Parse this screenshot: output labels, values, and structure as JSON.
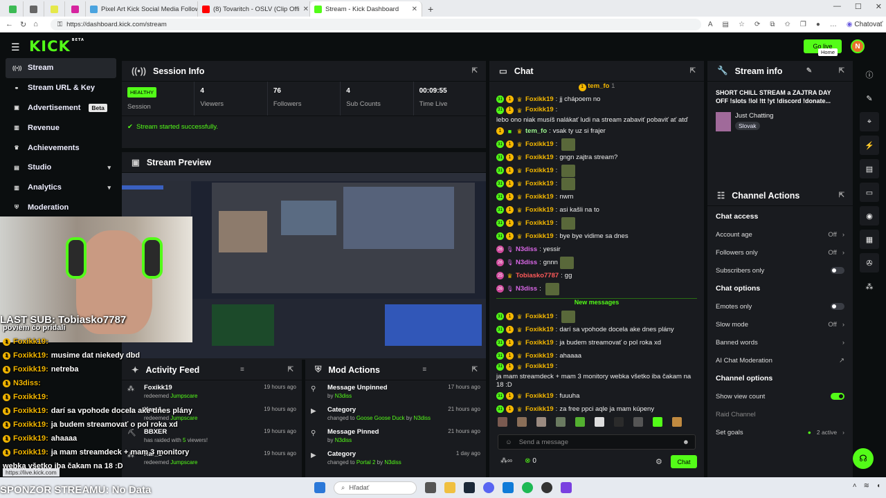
{
  "browser": {
    "tabs": [
      {
        "label": "",
        "color": "#3cba54"
      },
      {
        "label": "",
        "color": "#666"
      },
      {
        "label": "",
        "color": "#e5e84a"
      },
      {
        "label": "",
        "color": "#d6249f"
      },
      {
        "label": "Pixel Art Kick Social Media Follow",
        "color": "#4aa3df"
      },
      {
        "label": "(8) Tovaritch - OSLV (Clip Offi",
        "color": "#ff0000"
      },
      {
        "label": "Stream - Kick Dashboard",
        "color": "#53fc18"
      }
    ],
    "url": "https://dashboard.kick.com/stream",
    "profile_label": "Chatovať",
    "status_url": "https://live.kick.com"
  },
  "topnav": {
    "logo": "KICK",
    "logo_beta": "BETA",
    "go_live": "Go live",
    "tooltip": "Home",
    "avatar_letter": "N"
  },
  "sidebar": {
    "items": [
      {
        "label": "Stream",
        "icon": "broadcast-icon"
      },
      {
        "label": "Stream URL & Key",
        "icon": "link-icon"
      },
      {
        "label": "Advertisement",
        "icon": "ad-icon",
        "badge": "Beta"
      },
      {
        "label": "Revenue",
        "icon": "chart-icon"
      },
      {
        "label": "Achievements",
        "icon": "trophy-icon"
      },
      {
        "label": "Studio",
        "icon": "studio-icon"
      },
      {
        "label": "Analytics",
        "icon": "analytics-icon"
      },
      {
        "label": "Moderation",
        "icon": "shield-icon"
      }
    ]
  },
  "session": {
    "title": "Session Info",
    "healthy": "HEALTHY",
    "session_label": "Session",
    "stats": [
      {
        "value": "4",
        "label": "Viewers"
      },
      {
        "value": "76",
        "label": "Followers"
      },
      {
        "value": "4",
        "label": "Sub Counts"
      },
      {
        "value": "00:09:55",
        "label": "Time Live"
      }
    ],
    "message": "Stream started successfully."
  },
  "preview": {
    "title": "Stream Preview"
  },
  "activity": {
    "title": "Activity Feed",
    "items": [
      {
        "name": "Foxikk19",
        "verb": "redeemed",
        "target": "Jumpscare",
        "tail": "",
        "time": "19 hours ago"
      },
      {
        "name": "Xar_1",
        "verb": "redeemed",
        "target": "Jumpscare",
        "tail": "",
        "time": "19 hours ago"
      },
      {
        "name": "BBXER",
        "verb": "has raided with",
        "target": "5",
        "tail": "viewers!",
        "time": "19 hours ago"
      },
      {
        "name": "Xar_1",
        "verb": "redeemed",
        "target": "Jumpscare",
        "tail": "",
        "time": "19 hours ago"
      }
    ]
  },
  "mod": {
    "title": "Mod Actions",
    "items": [
      {
        "title": "Message Unpinned",
        "sub": "by",
        "by": "N3diss",
        "time": "17 hours ago"
      },
      {
        "title": "Category",
        "sub": "changed to",
        "target": "Goose Goose Duck",
        "by": "N3diss",
        "time": "21 hours ago"
      },
      {
        "title": "Message Pinned",
        "sub": "by",
        "by": "N3diss",
        "time": "21 hours ago"
      },
      {
        "title": "Category",
        "sub": "changed to",
        "target": "Portal 2",
        "by": "N3diss",
        "time": "1 day ago"
      }
    ]
  },
  "chat": {
    "title": "Chat",
    "pinned_user": "tem_fo",
    "pinned_count": "1",
    "messages": [
      {
        "user": "Foxikk19",
        "cls": "nf",
        "text": "jj chápoem no",
        "badges": "sub"
      },
      {
        "user": "Foxikk19",
        "cls": "nf",
        "text": "lebo ono niak musíš nalákať ludi na stream zabaviť pobaviť ať atď",
        "badges": "sub"
      },
      {
        "user": "tem_fo",
        "cls": "nt2",
        "text": "vsak ty uz si frajer",
        "badges": "tem"
      },
      {
        "user": "Foxikk19",
        "cls": "nf",
        "text": "",
        "badges": "sub",
        "emote": true
      },
      {
        "user": "Foxikk19",
        "cls": "nf",
        "text": "gngn zajtra stream?",
        "badges": "sub"
      },
      {
        "user": "Foxikk19",
        "cls": "nf",
        "text": "",
        "badges": "sub",
        "emote": true
      },
      {
        "user": "Foxikk19",
        "cls": "nf",
        "text": "",
        "badges": "sub",
        "emote": true
      },
      {
        "user": "Foxikk19",
        "cls": "nf",
        "text": "nwm",
        "badges": "sub"
      },
      {
        "user": "Foxikk19",
        "cls": "nf",
        "text": "asi kašli na to",
        "badges": "sub"
      },
      {
        "user": "Foxikk19",
        "cls": "nf",
        "text": "",
        "badges": "sub",
        "emote": true
      },
      {
        "user": "Foxikk19",
        "cls": "nf",
        "text": "bye bye vidime sa dnes",
        "badges": "sub"
      },
      {
        "user": "N3diss",
        "cls": "nn",
        "text": "yessir",
        "badges": "mod"
      },
      {
        "user": "N3diss",
        "cls": "nn",
        "text": "gnnn",
        "badges": "mod",
        "emote": true
      },
      {
        "user": "Tobiasko7787",
        "cls": "nt",
        "text": "gg",
        "badges": "tob"
      },
      {
        "user": "N3diss",
        "cls": "nn",
        "text": "",
        "badges": "mod",
        "emote": true
      }
    ],
    "new_messages": "New messages",
    "messages2": [
      {
        "user": "Foxikk19",
        "cls": "nf",
        "text": "",
        "emote": true
      },
      {
        "user": "Foxikk19",
        "cls": "nf",
        "text": "darí sa vpohode docela ake dnes plány"
      },
      {
        "user": "Foxikk19",
        "cls": "nf",
        "text": "ja budem streamovať o pol roka xd"
      },
      {
        "user": "Foxikk19",
        "cls": "nf",
        "text": "ahaaaa"
      },
      {
        "user": "Foxikk19",
        "cls": "nf",
        "text": "ja mam streamdeck + mam 3 monitory webka všetko iba čakam na 18 :D"
      },
      {
        "user": "Foxikk19",
        "cls": "nf",
        "text": "fuuuha"
      },
      {
        "user": "Foxikk19",
        "cls": "nf",
        "text": "za free ppci aqle ja mam kúpeny"
      }
    ],
    "placeholder": "Send a message",
    "counter": "0",
    "send": "Chat"
  },
  "stream_info": {
    "title": "Stream info",
    "stream_title": "SHORT CHILL STREAM a ZAJTRA DAY OFF !slots !lol !tt !yt !discord !donate...",
    "category": "Just Chatting",
    "language": "Slovak"
  },
  "channel_actions": {
    "title": "Channel Actions",
    "chat_access": "Chat access",
    "account_age": "Account age",
    "account_age_val": "Off",
    "followers_only": "Followers only",
    "followers_only_val": "Off",
    "subscribers_only": "Subscribers only",
    "chat_options": "Chat options",
    "emotes_only": "Emotes only",
    "slow_mode": "Slow mode",
    "slow_mode_val": "Off",
    "banned_words": "Banned words",
    "ai_mod": "AI Chat Moderation",
    "channel_options": "Channel options",
    "show_view_count": "Show view count",
    "raid_channel": "Raid Channel",
    "set_goals": "Set goals",
    "goals_val": "2 active"
  },
  "overlay": {
    "last_sub": "LAST SUB: Tobiasko7787",
    "sponzor": "SPONZOR STREAMU: No Data",
    "lines": [
      {
        "user": "",
        "text": "poviem čo pridali"
      },
      {
        "user": "Foxikk19:",
        "text": ""
      },
      {
        "user": "Foxikk19:",
        "text": "musime dat niekedy dbd"
      },
      {
        "user": "Foxikk19:",
        "text": "netreba"
      },
      {
        "user": "N3diss:",
        "text": ""
      },
      {
        "user": "Foxikk19:",
        "text": ""
      },
      {
        "user": "Foxikk19:",
        "text": "darí sa vpohode docela ake dnes plány"
      },
      {
        "user": "Foxikk19:",
        "text": "ja budem streamovať o pol roka xd"
      },
      {
        "user": "Foxikk19:",
        "text": "ahaaaa"
      },
      {
        "user": "Foxikk19:",
        "text": "ja mam streamdeck + mam 3 monitory"
      },
      {
        "user": "",
        "text": "webka všetko iba čakam na 18 :D"
      }
    ]
  },
  "taskbar": {
    "search": "Hľadať"
  }
}
